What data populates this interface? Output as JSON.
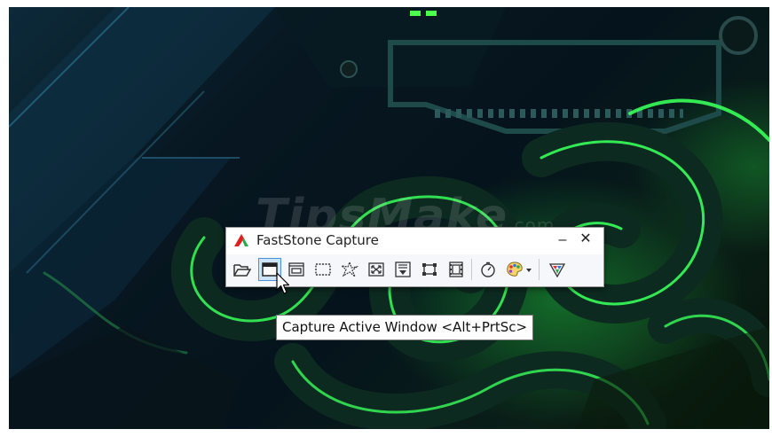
{
  "window": {
    "title": "FastStone Capture",
    "minimize_glyph": "–",
    "close_glyph": "✕"
  },
  "watermark": {
    "text": "TipsMake",
    "suffix": ".com"
  },
  "toolbar": {
    "buttons": [
      {
        "name": "open-folder",
        "icon": "folder-open-icon"
      },
      {
        "name": "capture-active-window",
        "icon": "active-window-icon",
        "active": true
      },
      {
        "name": "capture-window-object",
        "icon": "window-object-icon"
      },
      {
        "name": "capture-rectangular-region",
        "icon": "rectangle-region-icon"
      },
      {
        "name": "capture-freehand-region",
        "icon": "freehand-region-icon"
      },
      {
        "name": "capture-full-screen",
        "icon": "full-screen-icon"
      },
      {
        "name": "capture-scrolling-window",
        "icon": "scrolling-window-icon"
      },
      {
        "name": "capture-fixed-region",
        "icon": "fixed-region-icon"
      },
      {
        "name": "screen-recorder",
        "icon": "film-icon"
      },
      {
        "name": "delay-timer",
        "icon": "timer-icon"
      },
      {
        "name": "output-options",
        "icon": "palette-icon"
      },
      {
        "name": "settings-menu",
        "icon": "faststone-menu-icon"
      }
    ]
  },
  "tooltip": {
    "text": "Capture Active Window <Alt+PrtSc>"
  },
  "colors": {
    "accent_active": "#4a90d9",
    "logo_red": "#e02020",
    "logo_green": "#2aa84a",
    "wallpaper_green": "#39ff5a"
  }
}
